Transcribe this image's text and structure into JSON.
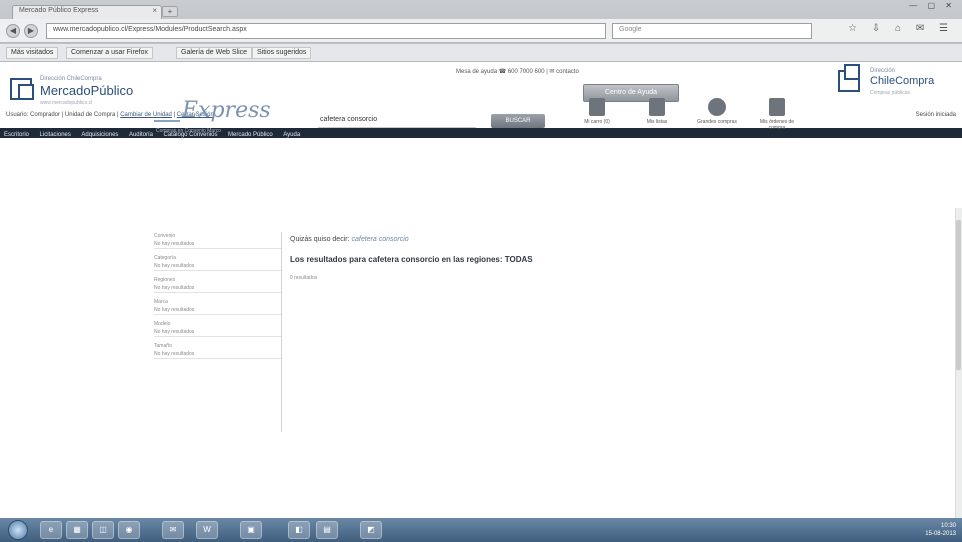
{
  "browser": {
    "tab_title": "Mercado Público Express",
    "tab_close": "×",
    "new_tab": "+",
    "window_controls": "— ▢ ✕",
    "url": "www.mercadopublico.cl/Express/Modules/ProductSearch.aspx",
    "search_placeholder": "Google",
    "toolbar_icons": "☆ ⇩ ⌂ ✉ ☰",
    "bookmarks": [
      "Más visitados",
      "Comenzar a usar Firefox",
      "Galería de Web Slice",
      "Sitios sugeridos"
    ]
  },
  "header": {
    "mp_logo_small": "Dirección ChileCompra",
    "mp_logo_text": "MercadoPúblico",
    "mp_logo_sub": "www.mercadopublico.cl",
    "support_line": "Mesa de ayuda  ☎ 600 7000 600  |  ✉ contacto",
    "support_button": "Centro de Ayuda",
    "cc_logo_small": "Dirección",
    "cc_logo_text": "ChileCompra",
    "cc_logo_sub": "Compras públicas",
    "user_line": "Usuario: Comprador  |  Unidad de Compra",
    "user_link_profile": "Cambiar de Unidad",
    "user_link_logout": "Cerrar Sesión",
    "date_line": "Sesión iniciada"
  },
  "main_nav": [
    "Escritorio",
    "Licitaciones",
    "Adquisiciones",
    "Auditoría",
    "Catálogo Convenios",
    "Mercado Público",
    "Ayuda"
  ],
  "express": {
    "logo_text": "Express",
    "logo_sub": "Compras en Convenio Marco",
    "search_value": "cafetera consorcio",
    "search_button": "BUSCAR",
    "tools": [
      {
        "label": "Mi carro (0)",
        "icon": "cart-icon"
      },
      {
        "label": "Mis listas",
        "icon": "list-icon"
      },
      {
        "label": "Grandes compras",
        "icon": "box-icon"
      },
      {
        "label": "Mis órdenes de compra",
        "icon": "orders-icon"
      }
    ]
  },
  "sidebar": {
    "groups": [
      {
        "title": "Convenio",
        "value": "No hay resultados"
      },
      {
        "title": "Categoría",
        "value": "No hay resultados"
      },
      {
        "title": "Regiones",
        "value": "No hay resultados"
      },
      {
        "title": "Marca",
        "value": "No hay resultados"
      },
      {
        "title": "Modelo",
        "value": "No hay resultados"
      },
      {
        "title": "Tamaño",
        "value": "No hay resultados"
      }
    ]
  },
  "results": {
    "did_you_mean_prefix": "Quizás quiso decir:",
    "did_you_mean_suggestion": "cafetera consorcio",
    "title": "Los resultados para cafetera consorcio en las regiones: TODAS",
    "note": "0 resultados"
  },
  "taskbar": {
    "items": [
      "e",
      "▦",
      "◫",
      "◉",
      "✉",
      "W",
      "▣",
      "◧",
      "▤",
      "◩"
    ],
    "tray_time": "10:30",
    "tray_date": "15-08-2013"
  }
}
